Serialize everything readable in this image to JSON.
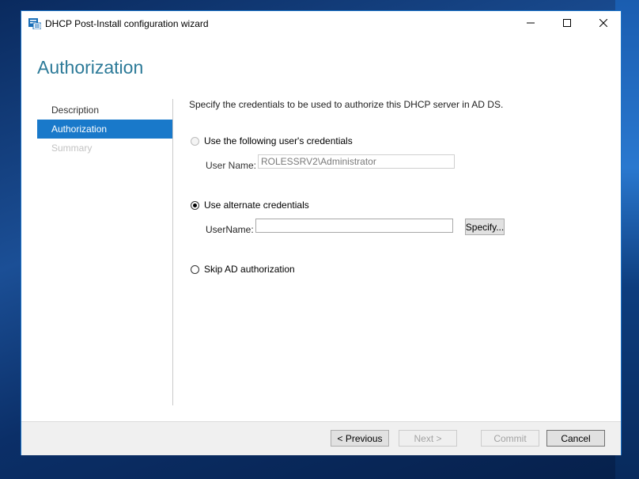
{
  "window": {
    "title": "DHCP Post-Install configuration wizard",
    "controls": {
      "minimize": "minimize",
      "maximize": "maximize",
      "close": "close"
    }
  },
  "page": {
    "heading": "Authorization"
  },
  "nav": {
    "items": [
      {
        "label": "Description",
        "state": "normal"
      },
      {
        "label": "Authorization",
        "state": "active"
      },
      {
        "label": "Summary",
        "state": "disabled"
      }
    ]
  },
  "main": {
    "description": "Specify the credentials to be used to authorize this DHCP server in AD DS.",
    "options": {
      "current_user": {
        "label": "Use the following user's credentials",
        "selected": false,
        "enabled": false,
        "username_label": "User Name:",
        "username_value": "ROLESSRV2\\Administrator"
      },
      "alternate": {
        "label": "Use alternate credentials",
        "selected": true,
        "username_label": "UserName:",
        "username_value": "",
        "specify_label": "Specify..."
      },
      "skip": {
        "label": "Skip AD authorization",
        "selected": false
      }
    }
  },
  "footer": {
    "previous_label": "< Previous",
    "next_label": "Next >",
    "commit_label": "Commit",
    "cancel_label": "Cancel"
  },
  "colors": {
    "accent": "#1979ca",
    "heading": "#2c7a98",
    "window_border": "#1c74c9"
  }
}
